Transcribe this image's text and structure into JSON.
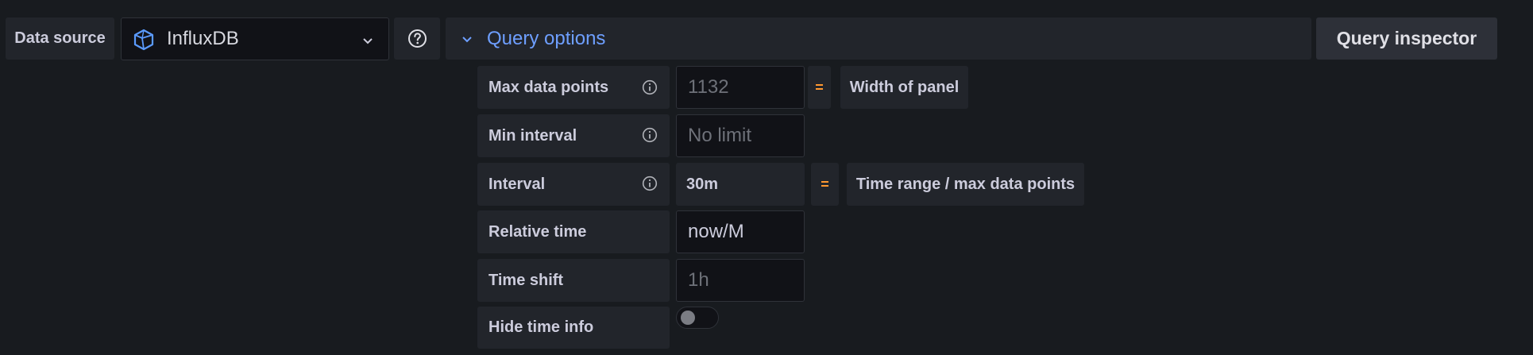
{
  "datasource": {
    "label": "Data source",
    "name": "InfluxDB",
    "icon": "influxdb-icon",
    "dropdown_icon": "chevron-down-icon"
  },
  "help_icon": "question-circle-icon",
  "query_options": {
    "title": "Query options",
    "collapse_icon": "chevron-down-icon",
    "accent_color": "#6e9fff"
  },
  "query_inspector": {
    "label": "Query inspector"
  },
  "options": {
    "max_data_points": {
      "label": "Max data points",
      "placeholder": "1132",
      "equals": "=",
      "note": "Width of panel"
    },
    "min_interval": {
      "label": "Min interval",
      "placeholder": "No limit"
    },
    "interval": {
      "label": "Interval",
      "value": "30m",
      "equals": "=",
      "note": "Time range / max data points"
    },
    "relative_time": {
      "label": "Relative time",
      "value": "now/M"
    },
    "time_shift": {
      "label": "Time shift",
      "placeholder": "1h"
    },
    "hide_time_info": {
      "label": "Hide time info",
      "enabled": false
    }
  }
}
